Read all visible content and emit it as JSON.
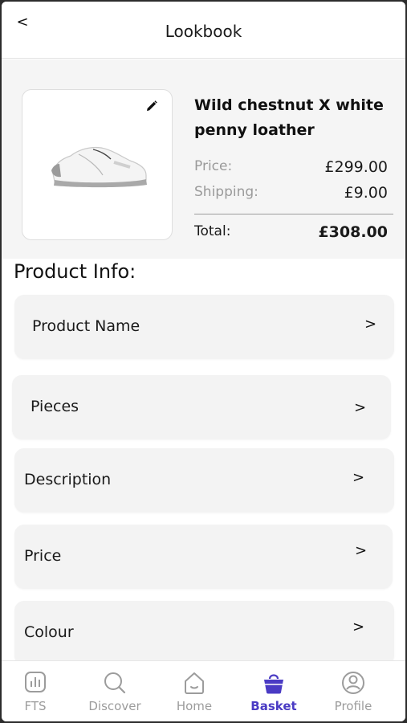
{
  "header": {
    "back_label": "<",
    "title": "Lookbook"
  },
  "product": {
    "title": "Wild chestnut  X white penny loather",
    "price_label": "Price:",
    "price_value": "£299.00",
    "shipping_label": "Shipping:",
    "shipping_value": "£9.00",
    "total_label": "Total:",
    "total_value": "£308.00"
  },
  "section_title": "Product Info:",
  "info_cards": [
    {
      "label": "Product Name",
      "chevron": ">"
    },
    {
      "label": "Pieces",
      "chevron": ">"
    },
    {
      "label": "Description",
      "chevron": ">"
    },
    {
      "label": "Price",
      "chevron": ">"
    },
    {
      "label": "Colour",
      "chevron": ">"
    }
  ],
  "nav": [
    {
      "label": "FTS",
      "icon": "chart-icon"
    },
    {
      "label": "Discover",
      "icon": "search-icon"
    },
    {
      "label": "Home",
      "icon": "home-icon"
    },
    {
      "label": "Basket",
      "icon": "basket-icon",
      "active": true
    },
    {
      "label": "Profile",
      "icon": "profile-icon"
    }
  ],
  "colors": {
    "accent": "#4a3bc4",
    "muted": "#9c9c9c",
    "panel": "#f5f5f5"
  }
}
